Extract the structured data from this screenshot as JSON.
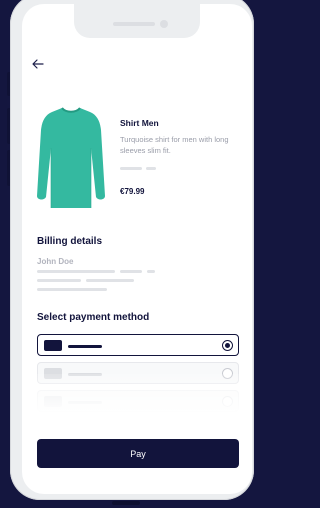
{
  "product": {
    "name": "Shirt Men",
    "description": "Turquoise shirt for men with long sleeves slim fit.",
    "price": "€79.99",
    "image_icon": "turquoise-long-sleeve-shirt",
    "image_color": "#34b9a0"
  },
  "billing": {
    "title": "Billing details",
    "name": "John Doe"
  },
  "payment": {
    "title": "Select payment method",
    "options": [
      {
        "selected": true
      },
      {
        "selected": false
      },
      {
        "selected": false
      }
    ]
  },
  "actions": {
    "pay_label": "Pay"
  },
  "colors": {
    "brand_dark": "#12143c",
    "background": "#14163f",
    "muted_text": "#9a9da9"
  }
}
